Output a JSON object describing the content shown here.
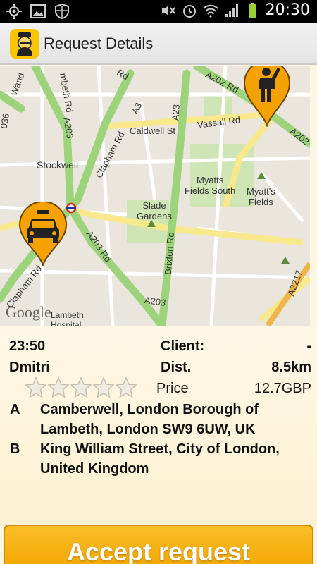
{
  "status_bar": {
    "time": "20:30",
    "icons": [
      "gps-icon",
      "gallery-icon",
      "shield-icon",
      "mute-icon",
      "alarm-icon",
      "wifi-icon",
      "signal-icon",
      "battery-icon"
    ]
  },
  "action_bar": {
    "title": "Request Details",
    "app_icon": "taxi-driver-icon"
  },
  "map": {
    "labels": {
      "stockwell": "Stockwell",
      "slade_gardens": "Slade\nGardens",
      "myatts_fields_south": "Myatts\nFields South",
      "myatts_fields": "Myatt's\nFields",
      "caldwell_st": "Caldwell St",
      "vassall_rd": "Vassall Rd",
      "clapham_rd_1": "Clapham Rd",
      "clapham_rd_2": "Clapham Rd",
      "brixton_rd": "Brixton Rd",
      "a202_rd": "A202 Rd",
      "a203_1": "A203",
      "a203_2": "A203",
      "a203_rd": "A203 Rd",
      "a23": "A23",
      "a3": "A3",
      "a202": "A202",
      "a2217": "A2217",
      "lambeth": "Lambeth\nHospital",
      "wand": "Wand",
      "a36": "036",
      "mbeth_rd": "mbeth Rd",
      "bo_rd": "Rd"
    },
    "google": "Google",
    "pins": [
      "taxi-pin-icon",
      "client-pin-icon"
    ]
  },
  "details": {
    "time": "23:50",
    "client_label": "Client:",
    "client_value": "-",
    "name": "Dmitri",
    "dist_label": "Dist.",
    "dist_value": "8.5km",
    "price_label": "Price",
    "price_value": "12.7GBP",
    "rating": 0,
    "rating_max": 5,
    "addresses": [
      {
        "letter": "A",
        "text": "Camberwell, London Borough of Lambeth, London SW9 6UW, UK"
      },
      {
        "letter": "B",
        "text": "King William Street, City of London, United Kingdom"
      }
    ]
  },
  "accept_button": {
    "label": "Accept request"
  },
  "colors": {
    "accent": "#f5a800",
    "map_road_major": "#9dd37a",
    "map_road_minor": "#ffffff",
    "map_road_yellow": "#f8e98c",
    "map_bg": "#eae6dd",
    "pin_orange": "#f5a100"
  }
}
